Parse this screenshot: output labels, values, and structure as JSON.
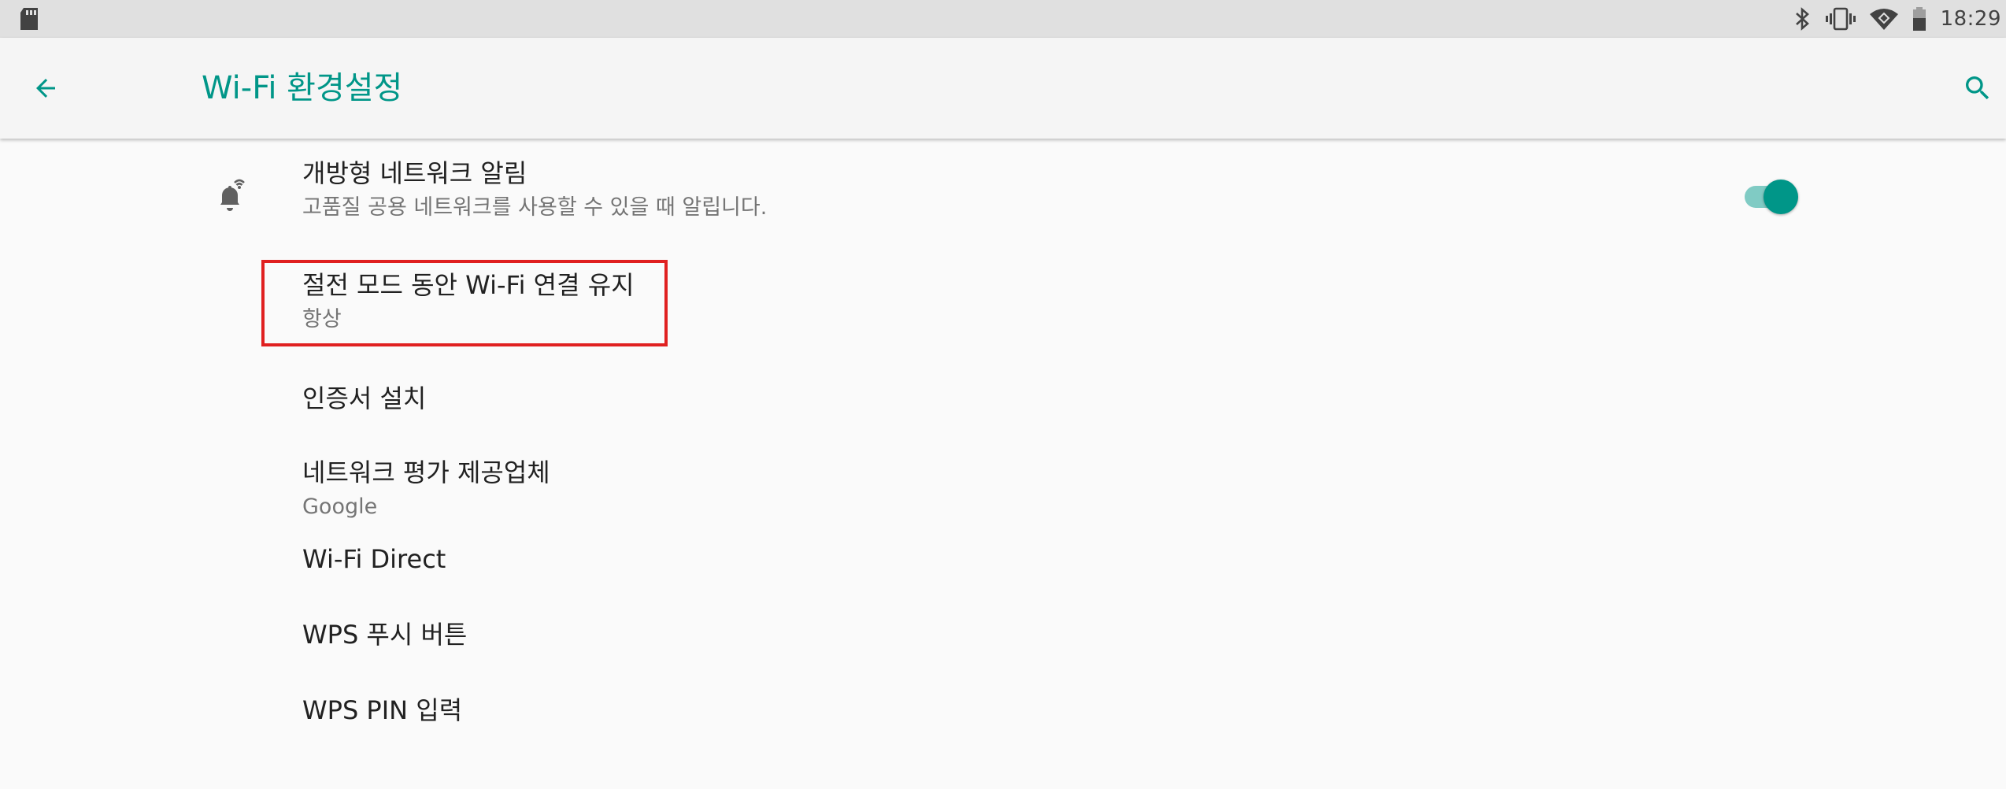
{
  "status_bar": {
    "time": "18:29",
    "icons": [
      "sd-card-icon",
      "bluetooth-icon",
      "vibrate-icon",
      "wifi-icon",
      "battery-icon"
    ]
  },
  "app_bar": {
    "title": "Wi-Fi 환경설정",
    "accent_color": "#009688"
  },
  "preferences": [
    {
      "id": "open-network-notification",
      "title": "개방형 네트워크 알림",
      "summary": "고품질 공용 네트워크를 사용할 수 있을 때 알립니다.",
      "icon": "wifi-notification-bell-icon",
      "toggle": true
    },
    {
      "id": "keep-wifi-during-sleep",
      "title": "절전 모드 동안 Wi-Fi 연결 유지",
      "summary": "항상",
      "highlighted": true
    },
    {
      "id": "install-certificates",
      "title": "인증서 설치"
    },
    {
      "id": "network-rating-provider",
      "title": "네트워크 평가 제공업체",
      "summary": "Google"
    },
    {
      "id": "wifi-direct",
      "title": "Wi-Fi Direct"
    },
    {
      "id": "wps-push-button",
      "title": "WPS 푸시 버튼"
    },
    {
      "id": "wps-pin-entry",
      "title": "WPS PIN 입력"
    }
  ],
  "highlight_color": "#e02020"
}
